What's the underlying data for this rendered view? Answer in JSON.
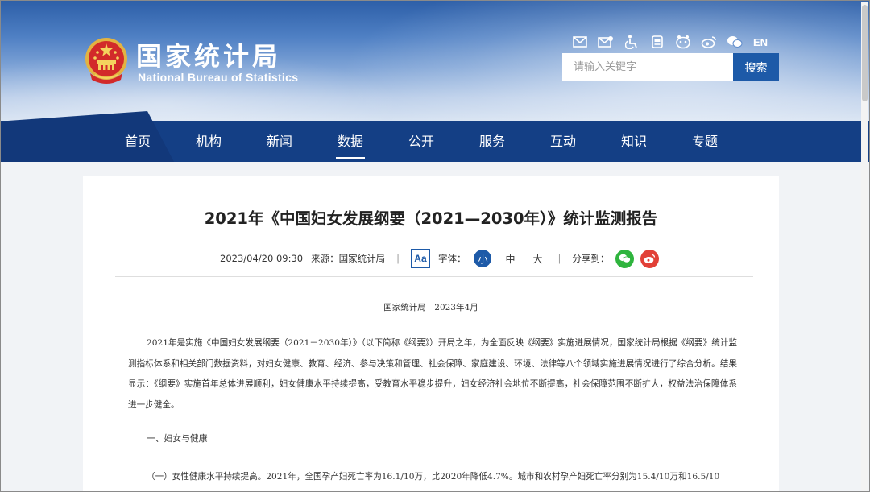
{
  "header": {
    "logo_cn": "国家统计局",
    "logo_en": "National Bureau of Statistics",
    "lang_link": "EN",
    "icons": [
      "mail-icon",
      "subscribe-icon",
      "accessibility-icon",
      "elder-mode-icon",
      "wechat-mini-icon",
      "weibo-icon",
      "wechat-icon"
    ],
    "search": {
      "placeholder": "请输入关键字",
      "button": "搜索"
    }
  },
  "nav": {
    "items": [
      "首页",
      "机构",
      "新闻",
      "数据",
      "公开",
      "服务",
      "互动",
      "知识",
      "专题"
    ],
    "active": "数据"
  },
  "article": {
    "title": "2021年《中国妇女发展纲要（2021—2030年）》统计监测报告",
    "datetime": "2023/04/20 09:30",
    "source": "来源：国家统计局",
    "aa_label": "Aa",
    "font_label": "字体：",
    "font_sizes": [
      "小",
      "中",
      "大"
    ],
    "share_label": "分享到：",
    "byline": "国家统计局　2023年4月",
    "intro": "2021年是实施《中国妇女发展纲要（2021－2030年）》（以下简称《纲要》）开局之年，为全面反映《纲要》实施进展情况，国家统计局根据《纲要》统计监测指标体系和相关部门数据资料，对妇女健康、教育、经济、参与决策和管理、社会保障、家庭建设、环境、法律等八个领域实施进展情况进行了综合分析。结果显示：《纲要》实施首年总体进展顺利，妇女健康水平持续提高，受教育水平稳步提升，妇女经济社会地位不断提高，社会保障范围不断扩大，权益法治保障体系进一步健全。",
    "section1": "一、妇女与健康",
    "section1_p1": "（一）女性健康水平持续提高。2021年，全国孕产妇死亡率为16.1/10万，比2020年降低4.7%。城市和农村孕产妇死亡率分别为15.4/10万和16.5/10"
  },
  "colors": {
    "nav_bg": "#143f85",
    "accent": "#1d5aa8",
    "wechat": "#2fb43e",
    "weibo": "#e24037"
  }
}
